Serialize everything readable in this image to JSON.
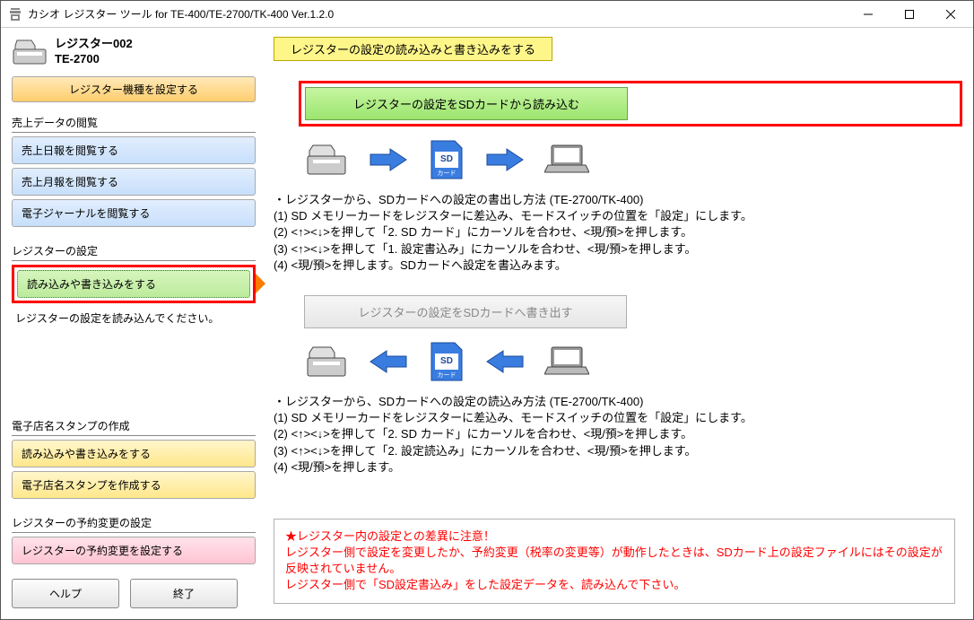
{
  "title": "カシオ レジスター ツール for TE-400/TE-2700/TK-400 Ver.1.2.0",
  "register": {
    "name": "レジスター002",
    "model": "TE-2700"
  },
  "sidebar": {
    "config_model_btn": "レジスター機種を設定する",
    "section_sales": "売上データの閲覧",
    "sales_daily": "売上日報を閲覧する",
    "sales_monthly": "売上月報を閲覧する",
    "journal": "電子ジャーナルを閲覧する",
    "section_settings": "レジスターの設定",
    "rw_settings": "読み込みや書き込みをする",
    "hint": "レジスターの設定を読み込んでください。",
    "section_stamp": "電子店名スタンプの作成",
    "stamp_rw": "読み込みや書き込みをする",
    "stamp_create": "電子店名スタンプを作成する",
    "section_reserve": "レジスターの予約変更の設定",
    "reserve_btn": "レジスターの予約変更を設定する",
    "help": "ヘルプ",
    "exit": "終了"
  },
  "content": {
    "banner": "レジスターの設定の読み込みと書き込みをする",
    "read_btn": "レジスターの設定をSDカードから読み込む",
    "write_btn": "レジスターの設定をSDカードへ書き出す",
    "sd_label": "SD",
    "sd_sub": "カード",
    "instr_write": "・レジスターから、SDカードへの設定の書出し方法 (TE-2700/TK-400)\n(1) SD メモリーカードをレジスターに差込み、モードスイッチの位置を「設定」にします。\n(2) <↑><↓>を押して「2. SD カード」にカーソルを合わせ、<現/預>を押します。\n(3) <↑><↓>を押して「1. 設定書込み」にカーソルを合わせ、<現/預>を押します。\n(4) <現/預>を押します。SDカードへ設定を書込みます。",
    "instr_read": "・レジスターから、SDカードへの設定の読込み方法 (TE-2700/TK-400)\n(1) SD メモリーカードをレジスターに差込み、モードスイッチの位置を「設定」にします。\n(2) <↑><↓>を押して「2. SD カード」にカーソルを合わせ、<現/預>を押します。\n(3) <↑><↓>を押して「2. 設定読込み」にカーソルを合わせ、<現/預>を押します。\n(4) <現/預>を押します。",
    "warn": "★レジスター内の設定との差異に注意！\nレジスター側で設定を変更したか、予約変更（税率の変更等）が動作したときは、SDカード上の設定ファイルにはその設定が反映されていません。\nレジスター側で「SD設定書込み」をした設定データを、読み込んで下さい。"
  }
}
